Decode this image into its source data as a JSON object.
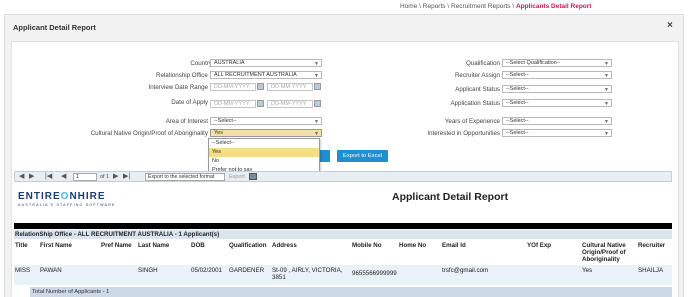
{
  "breadcrumb": {
    "items": [
      "Home",
      "Reports",
      "Recruitment Reports"
    ],
    "separator": " \\ ",
    "active": "Applicants Detail Report"
  },
  "modal": {
    "title": "Applicant Detail Report",
    "close": "×"
  },
  "filters": {
    "country": {
      "label": "Country",
      "value": "AUSTRALIA"
    },
    "relationship_office": {
      "label": "Relationship Office",
      "required": "*",
      "value": "ALL RECRUITMENT AUSTRALIA"
    },
    "interview_date_range": {
      "label": "Interview Date Range",
      "from_placeholder": "DD-MM-YYYY",
      "to_placeholder": "DD-MM-YYYY"
    },
    "date_of_apply": {
      "label": "Date of Apply",
      "from_placeholder": "DD-MM-YYYY",
      "to_placeholder": "DD-MM-YYYY"
    },
    "area_of_interest": {
      "label": "Area of Interest",
      "value": "--Select--"
    },
    "cultural_native_origin": {
      "label": "Cultural Native Origin/Proof of Aboriginality",
      "value": "Yes"
    },
    "qualification": {
      "label": "Qualification",
      "value": "--Select Qualification--"
    },
    "recruiter_assign": {
      "label": "Recruiter Assign",
      "value": "--Select--"
    },
    "applicant_status": {
      "label": "Applicant Status",
      "value": "--Select--"
    },
    "application_status": {
      "label": "Application Status",
      "value": "--Select--"
    },
    "years_of_experience": {
      "label": "Years of Experience",
      "value": "--Select--"
    },
    "interested_in_opportunities": {
      "label": "Interested in Opportunities",
      "value": "--Select--"
    }
  },
  "dropdown": {
    "options": [
      "--Select--",
      "Yes",
      "No",
      "Prefer not to say"
    ],
    "highlighted": "Yes"
  },
  "buttons": {
    "submit_partial": "rt",
    "export_excel": "Export to Excel"
  },
  "toolbar": {
    "page_value": "1",
    "of_label": "of 1",
    "format_value": "Export to the selected format",
    "export_label": "Export"
  },
  "report": {
    "logo_main_a": "ENTIRE",
    "logo_main_o": "O",
    "logo_main_b": "NHIRE",
    "logo_sub": "AUSTRALIA'S STAFFING SOFTWARE",
    "title": "Applicant Detail Report",
    "group_header": "RelationShip Office - ALL RECRUITMENT AUSTRALIA - 1 Applicant(s)",
    "columns": [
      "Title",
      "First Name",
      "Pref Name",
      "Last Name",
      "DOB",
      "Qualification",
      "Address",
      "Mobile No",
      "Home No",
      "Email Id",
      "YOf Exp",
      "Cultural Native Origin/Proof of Aboriginality",
      "Recruiter"
    ],
    "row": {
      "title": "MISS",
      "first_name": "PAWAN",
      "pref_name": "",
      "last_name": "SINGH",
      "dob": "05/02/2001",
      "qualification": "GARDENER",
      "address": "St-09 , AIRLY, VICTORIA, 3851",
      "mobile": "9655566999999",
      "home": "",
      "email": "trsfc@gmail.com",
      "yof_exp": "",
      "cultural": "Yes",
      "recruiter": "SHAILJA"
    },
    "total": "Total Number of Applicants - 1"
  },
  "colors": {
    "accent_blue": "#1f8fd0",
    "breadcrumb_active": "#c2185b",
    "dropdown_highlight": "#f3dc8a",
    "selected_field": "#f6e0a3"
  }
}
